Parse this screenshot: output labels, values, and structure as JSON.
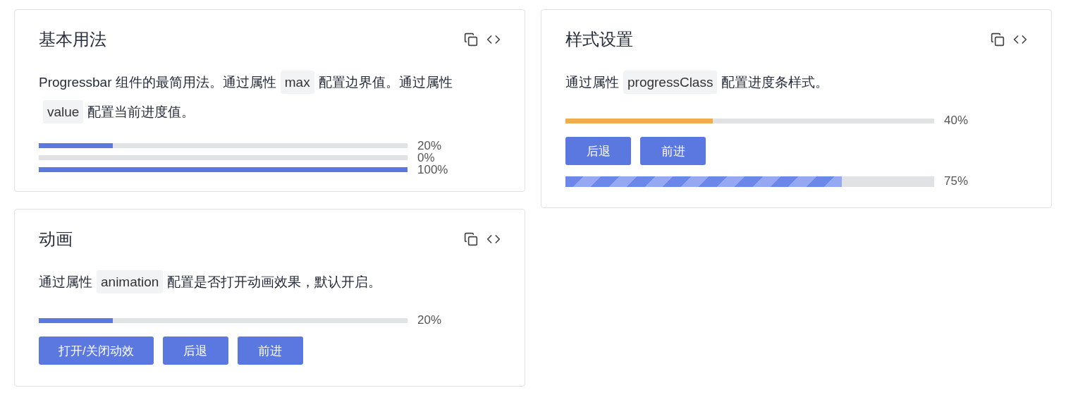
{
  "columns": [
    {
      "cards": [
        {
          "title": "基本用法",
          "description": [
            {
              "kind": "text",
              "text": "Progressbar 组件的最简用法。通过属性"
            },
            {
              "kind": "code",
              "text": "max"
            },
            {
              "kind": "text",
              "text": "配置边界值。通过属性"
            },
            {
              "kind": "code",
              "text": "value"
            },
            {
              "kind": "text",
              "text": "配置当前进度值。"
            }
          ],
          "items": [
            {
              "kind": "progress_stack",
              "bars": [
                {
                  "color": "#5b78e0",
                  "level": 0.2,
                  "label": "20%"
                },
                {
                  "level": 0,
                  "label": "0%"
                },
                {
                  "color": "#5b78e0",
                  "level": 1,
                  "label": "100%"
                }
              ]
            }
          ]
        },
        {
          "title": "动画",
          "description": [
            {
              "kind": "text",
              "text": "通过属性"
            },
            {
              "kind": "code",
              "text": "animation"
            },
            {
              "kind": "text",
              "text": "配置是否打开动画效果，默认开启。"
            }
          ],
          "items": [
            {
              "kind": "progress",
              "color": "#5b78e0",
              "level": 0.2,
              "label": "20%"
            },
            {
              "kind": "buttons",
              "buttons": [
                "打开/关闭动效",
                "后退",
                "前进"
              ]
            }
          ]
        }
      ]
    },
    {
      "cards": [
        {
          "title": "样式设置",
          "description": [
            {
              "kind": "text",
              "text": "通过属性"
            },
            {
              "kind": "code",
              "text": "progressClass"
            },
            {
              "kind": "text",
              "text": "配置进度条样式。"
            }
          ],
          "items": [
            {
              "kind": "progress",
              "color": "#f0ad4e",
              "level": 0.4,
              "label": "40%"
            },
            {
              "kind": "buttons",
              "buttons": [
                "后退",
                "前进"
              ]
            },
            {
              "kind": "striped_progress",
              "color": "#6c87ea",
              "level": 0.75,
              "label": "75%"
            }
          ]
        }
      ]
    }
  ]
}
